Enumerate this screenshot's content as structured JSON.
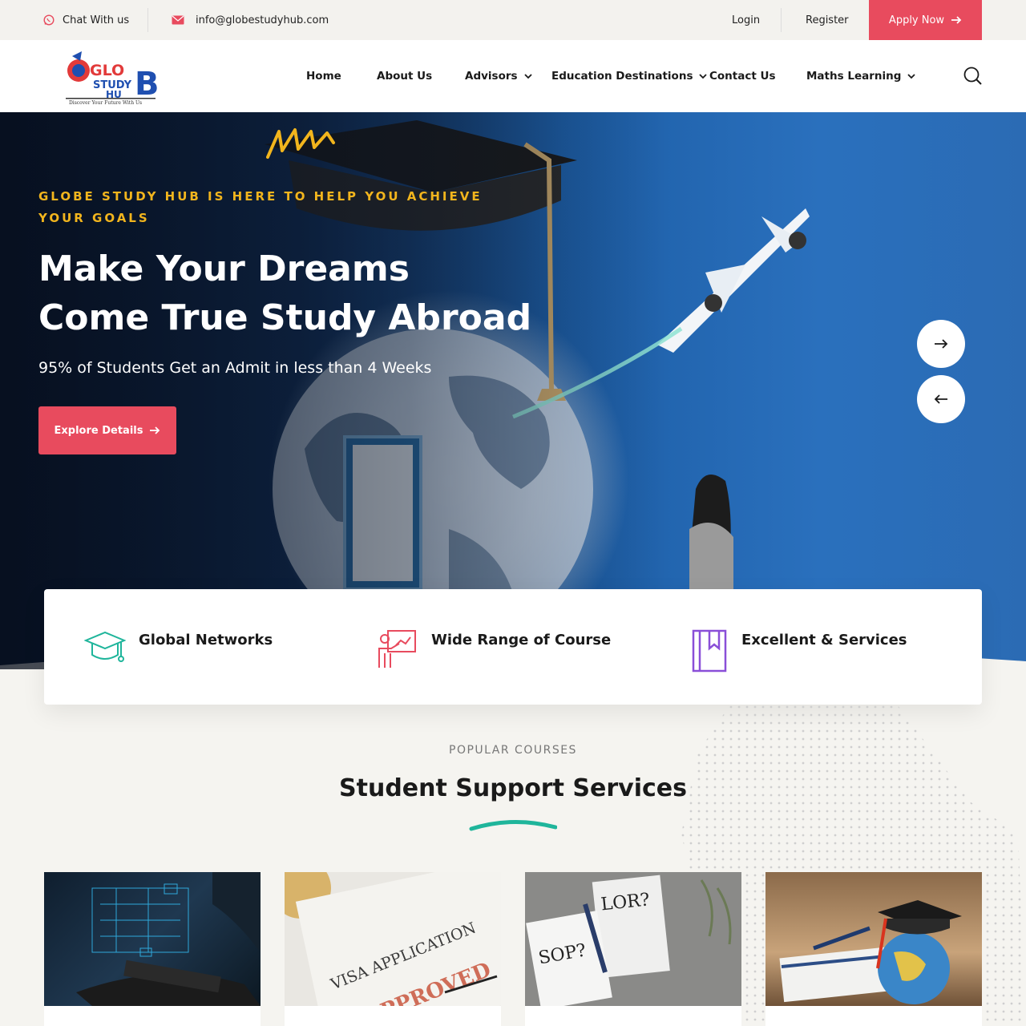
{
  "topbar": {
    "chat_label": "Chat With us",
    "email": "info@globestudyhub.com",
    "login": "Login",
    "register": "Register",
    "apply": "Apply Now"
  },
  "logo": {
    "line1": "GLO",
    "line2": "STUDY",
    "line3": "HU",
    "letter": "B",
    "tagline": "Discover Your Future With Us"
  },
  "nav": {
    "items": [
      {
        "label": "Home",
        "dropdown": false
      },
      {
        "label": "About Us",
        "dropdown": false
      },
      {
        "label": "Advisors",
        "dropdown": true
      },
      {
        "label": "Education Destinations",
        "dropdown": true
      },
      {
        "label": "Contact Us",
        "dropdown": false
      },
      {
        "label": "Maths Learning",
        "dropdown": true
      }
    ]
  },
  "hero": {
    "eyebrow": "GLOBE STUDY HUB IS HERE TO HELP YOU ACHIEVE YOUR GOALS",
    "headline_line1": "Make Your Dreams",
    "headline_line2": "Come True Study Abroad",
    "subtext": "95% of Students Get an Admit in less than 4 Weeks",
    "cta": "Explore Details"
  },
  "features": [
    {
      "label": "Global Networks",
      "icon": "graduation-cap-icon"
    },
    {
      "label": "Wide Range of Course",
      "icon": "teacher-board-icon"
    },
    {
      "label": "Excellent & Services",
      "icon": "bookmark-book-icon"
    }
  ],
  "section": {
    "eyebrow": "POPULAR COURSES",
    "title": "Student Support Services"
  },
  "cards": {
    "visa": {
      "title": "VISA APPLICATION",
      "stamp": "APPROVED"
    },
    "sop": {
      "sop": "SOP?",
      "lor": "LOR?"
    }
  },
  "colors": {
    "accent": "#e84b5e",
    "gold": "#f2b51d",
    "teal": "#1fb59b",
    "purple": "#8a4fd8"
  }
}
